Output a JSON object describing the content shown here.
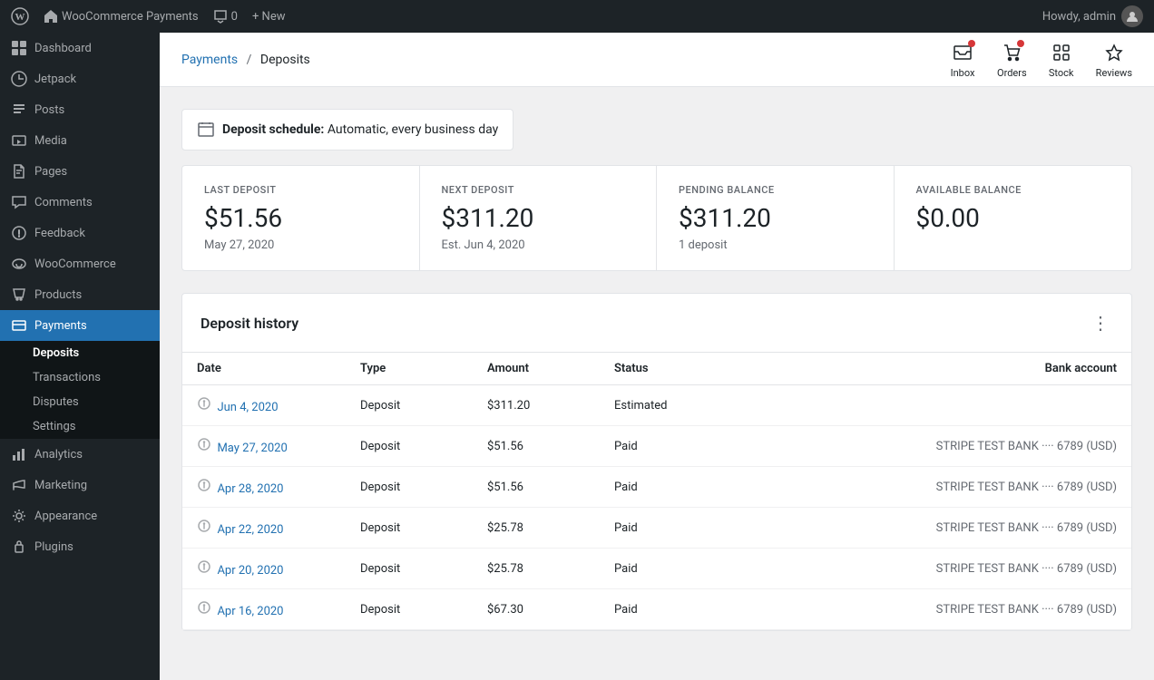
{
  "adminBar": {
    "siteName": "WooCommerce Payments",
    "comments": "0",
    "newLabel": "+ New",
    "howdy": "Howdy, admin"
  },
  "sidebar": {
    "items": [
      {
        "id": "dashboard",
        "label": "Dashboard",
        "icon": "dashboard"
      },
      {
        "id": "jetpack",
        "label": "Jetpack",
        "icon": "jetpack"
      },
      {
        "id": "posts",
        "label": "Posts",
        "icon": "posts"
      },
      {
        "id": "media",
        "label": "Media",
        "icon": "media"
      },
      {
        "id": "pages",
        "label": "Pages",
        "icon": "pages"
      },
      {
        "id": "comments",
        "label": "Comments",
        "icon": "comments"
      },
      {
        "id": "feedback",
        "label": "Feedback",
        "icon": "feedback"
      },
      {
        "id": "woocommerce",
        "label": "WooCommerce",
        "icon": "woocommerce"
      },
      {
        "id": "products",
        "label": "Products",
        "icon": "products"
      },
      {
        "id": "payments",
        "label": "Payments",
        "icon": "payments",
        "active": true
      },
      {
        "id": "analytics",
        "label": "Analytics",
        "icon": "analytics"
      },
      {
        "id": "marketing",
        "label": "Marketing",
        "icon": "marketing"
      },
      {
        "id": "appearance",
        "label": "Appearance",
        "icon": "appearance"
      },
      {
        "id": "plugins",
        "label": "Plugins",
        "icon": "plugins"
      }
    ],
    "paymentsSubMenu": [
      {
        "id": "deposits",
        "label": "Deposits",
        "active": true
      },
      {
        "id": "transactions",
        "label": "Transactions"
      },
      {
        "id": "disputes",
        "label": "Disputes"
      },
      {
        "id": "settings",
        "label": "Settings"
      }
    ]
  },
  "breadcrumb": {
    "parentLabel": "Payments",
    "currentLabel": "Deposits"
  },
  "topActions": [
    {
      "id": "inbox",
      "label": "Inbox",
      "hasBadge": true
    },
    {
      "id": "orders",
      "label": "Orders",
      "hasBadge": true
    },
    {
      "id": "stock",
      "label": "Stock",
      "hasBadge": false
    },
    {
      "id": "reviews",
      "label": "Reviews",
      "hasBadge": false
    }
  ],
  "depositSchedule": {
    "labelBold": "Deposit schedule:",
    "labelText": "Automatic, every business day"
  },
  "balanceCards": [
    {
      "label": "LAST DEPOSIT",
      "amount": "$51.56",
      "sub": "May 27, 2020"
    },
    {
      "label": "NEXT DEPOSIT",
      "amount": "$311.20",
      "sub": "Est. Jun 4, 2020"
    },
    {
      "label": "PENDING BALANCE",
      "amount": "$311.20",
      "sub": "1 deposit"
    },
    {
      "label": "AVAILABLE BALANCE",
      "amount": "$0.00",
      "sub": ""
    }
  ],
  "depositHistory": {
    "title": "Deposit history",
    "columns": [
      "Date",
      "Type",
      "Amount",
      "Status",
      "Bank account"
    ],
    "rows": [
      {
        "date": "Jun 4, 2020",
        "type": "Deposit",
        "amount": "$311.20",
        "status": "Estimated",
        "bank": ""
      },
      {
        "date": "May 27, 2020",
        "type": "Deposit",
        "amount": "$51.56",
        "status": "Paid",
        "bank": "STRIPE TEST BANK ···· 6789 (USD)"
      },
      {
        "date": "Apr 28, 2020",
        "type": "Deposit",
        "amount": "$51.56",
        "status": "Paid",
        "bank": "STRIPE TEST BANK ···· 6789 (USD)"
      },
      {
        "date": "Apr 22, 2020",
        "type": "Deposit",
        "amount": "$25.78",
        "status": "Paid",
        "bank": "STRIPE TEST BANK ···· 6789 (USD)"
      },
      {
        "date": "Apr 20, 2020",
        "type": "Deposit",
        "amount": "$25.78",
        "status": "Paid",
        "bank": "STRIPE TEST BANK ···· 6789 (USD)"
      },
      {
        "date": "Apr 16, 2020",
        "type": "Deposit",
        "amount": "$67.30",
        "status": "Paid",
        "bank": "STRIPE TEST BANK ···· 6789 (USD)"
      }
    ]
  }
}
